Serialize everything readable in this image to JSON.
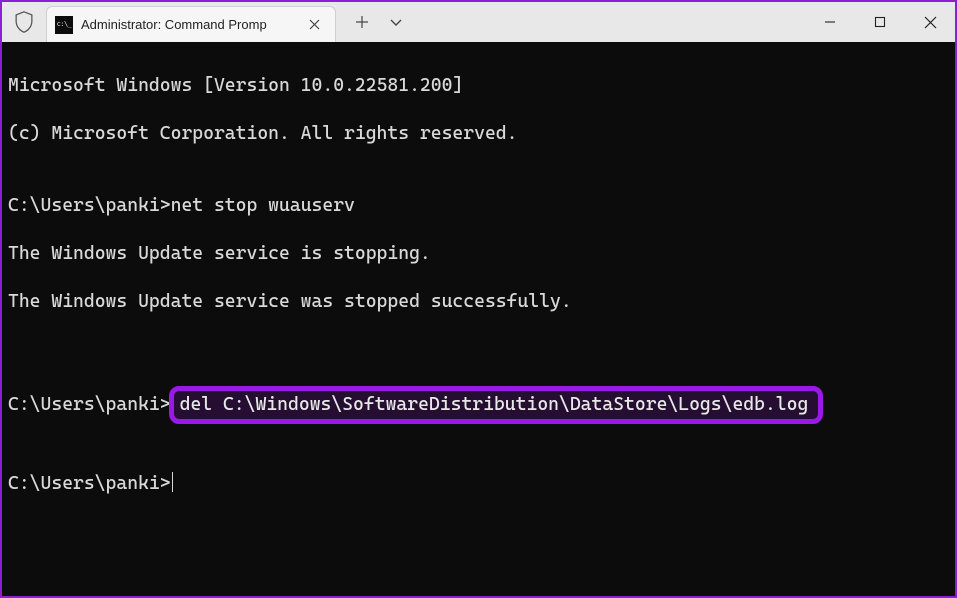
{
  "accent_color": "#8a1fd6",
  "titlebar": {
    "tab_title": "Administrator: Command Promp",
    "tab_icon_name": "cmd-icon"
  },
  "terminal": {
    "lines": {
      "l0": "Microsoft Windows [Version 10.0.22581.200]",
      "l1": "(c) Microsoft Corporation. All rights reserved.",
      "l2": "",
      "l3_prompt": "C:\\Users\\panki>",
      "l3_cmd": "net stop wuauserv",
      "l4": "The Windows Update service is stopping.",
      "l5": "The Windows Update service was stopped successfully.",
      "l6": "",
      "l7": "",
      "l8_prompt": "C:\\Users\\panki>",
      "l8_cmd": "del C:\\Windows\\SoftwareDistribution\\DataStore\\Logs\\edb.log",
      "l9": "",
      "l10_prompt": "C:\\Users\\panki>"
    }
  }
}
